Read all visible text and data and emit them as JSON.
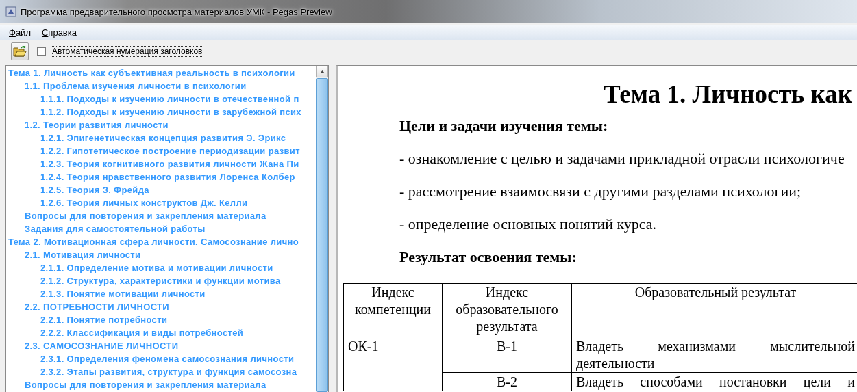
{
  "window": {
    "title": "Программа предварительного просмотра материалов УМК - Pegas Preview"
  },
  "menu": [
    {
      "label": "Файл"
    },
    {
      "label": "Справка"
    }
  ],
  "toolbar": {
    "auto_numbering": {
      "label": "Автоматическая нумерация заголовков",
      "checked": false
    }
  },
  "tree": [
    {
      "label": "Тема 1. Личность как субъективная реальность в психологии",
      "children": [
        {
          "label": "1.1. Проблема изучения личности в психологии",
          "children": [
            {
              "label": "1.1.1. Подходы к изучению личности в отечественной п"
            },
            {
              "label": "1.1.2. Подходы к изучению личности в зарубежной псих"
            }
          ]
        },
        {
          "label": "1.2. Теории развития личности",
          "children": [
            {
              "label": "1.2.1. Эпигенетическая концепция развития Э. Эрикс"
            },
            {
              "label": "1.2.2. Гипотетическое построение периодизации развит"
            },
            {
              "label": "1.2.3. Теория когнитивного развития личности Жана Пи"
            },
            {
              "label": "1.2.4. Теория нравственного развития Лоренса Колбер"
            },
            {
              "label": "1.2.5. Теория З. Фрейда"
            },
            {
              "label": "1.2.6. Теория личных конструктов Дж. Келли"
            }
          ]
        },
        {
          "label": "Вопросы для повторения и закрепления материала"
        },
        {
          "label": "Задания для самостоятельной работы"
        }
      ]
    },
    {
      "label": "Тема 2. Мотивационная сфера личности. Самосознание лично",
      "children": [
        {
          "label": "2.1. Мотивация личности",
          "children": [
            {
              "label": "2.1.1. Определение мотива и мотивации личности"
            },
            {
              "label": "2.1.2. Структура, характеристики и функции мотива"
            },
            {
              "label": "2.1.3. Понятие мотивации личности"
            }
          ]
        },
        {
          "label": "2.2. ПОТРЕБНОСТИ ЛИЧНОСТИ",
          "children": [
            {
              "label": "2.2.1. Понятие потребности"
            },
            {
              "label": "2.2.2. Классификация и виды потребностей"
            }
          ]
        },
        {
          "label": "2.3. САМОСОЗНАНИЕ ЛИЧНОСТИ",
          "children": [
            {
              "label": "2.3.1. Определения феномена самосознания личности"
            },
            {
              "label": "2.3.2. Этапы развития, структура и функция самосозна"
            }
          ]
        },
        {
          "label": "Вопросы для повторения и закрепления материала"
        }
      ]
    }
  ],
  "document": {
    "heading": "Тема 1. Личность как",
    "blocks": [
      {
        "kind": "subheading",
        "text": "Цели и задачи изучения темы:"
      },
      {
        "kind": "bullet",
        "text": "- ознакомление с целью и задачами прикладной отрасли психологиче"
      },
      {
        "kind": "bullet",
        "text": "- рассмотрение взаимосвязи с другими разделами психологии;"
      },
      {
        "kind": "bullet",
        "text": "- определение основных понятий курса."
      },
      {
        "kind": "subheading",
        "text": "Результат освоения темы:"
      }
    ],
    "table": {
      "columns": [
        "Индекс компетенции",
        "Индекс образовательного результата",
        "Образовательный результат"
      ],
      "groups": [
        {
          "competence": "ОК-1",
          "results": [
            {
              "index": "В-1",
              "text": "Владеть механизмами мыслительной деятельности"
            },
            {
              "index": "В-2",
              "text": "Владеть способами постановки цели и"
            }
          ]
        }
      ]
    }
  }
}
